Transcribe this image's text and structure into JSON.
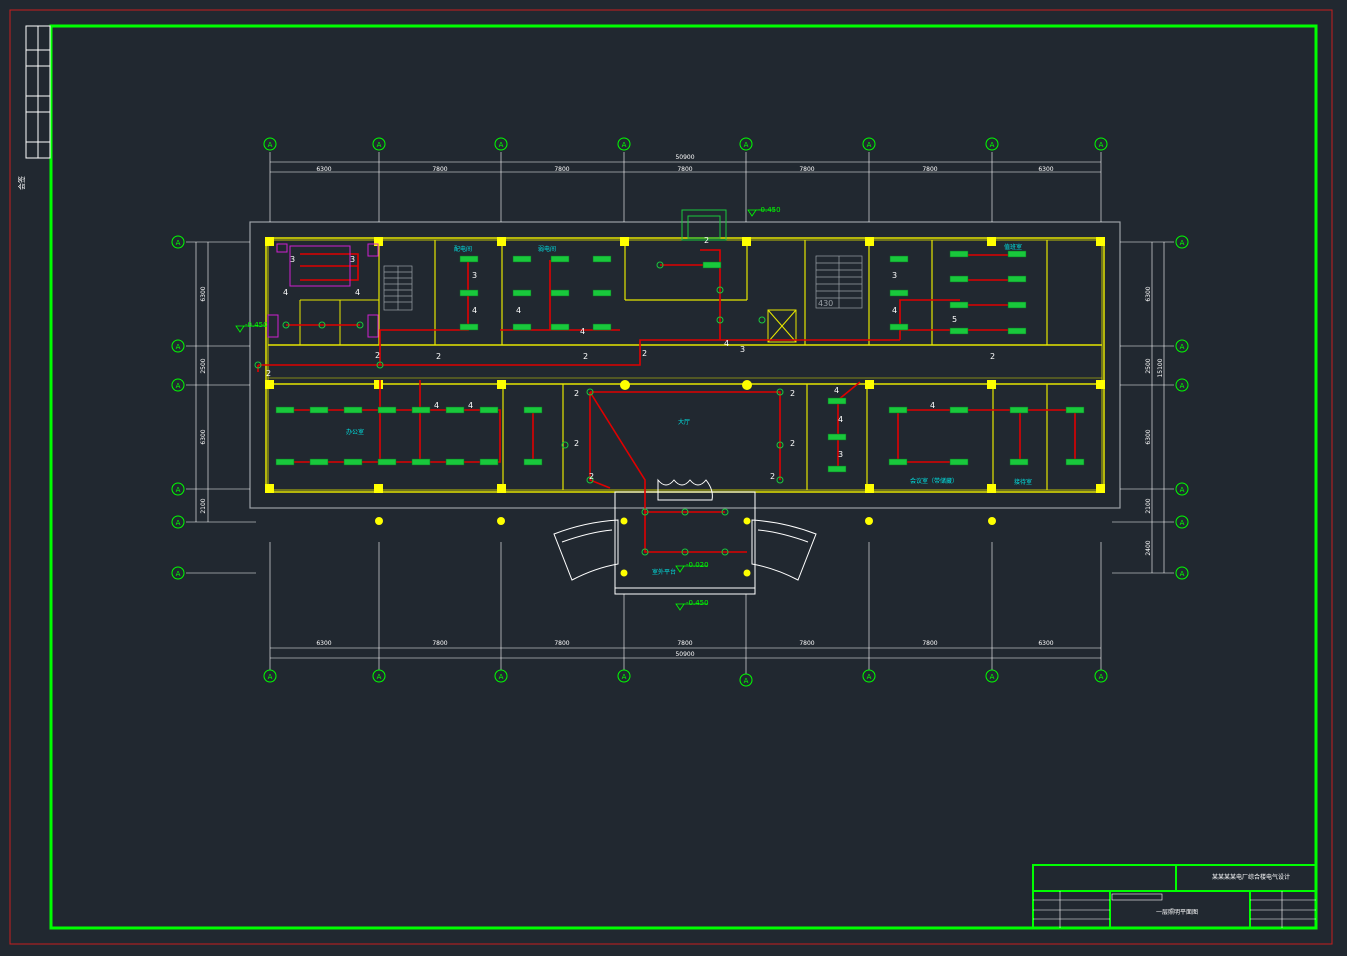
{
  "drawing": {
    "grid_top_labels": [
      "A",
      "A",
      "A",
      "A",
      "A",
      "A",
      "A",
      "A"
    ],
    "grid_side_labels": [
      "A",
      "A",
      "A",
      "A",
      "A",
      "A"
    ],
    "top_dims": [
      "6300",
      "7800",
      "7800",
      "7800",
      "7800",
      "7800",
      "6300"
    ],
    "top_total": "50900",
    "bottom_dims": [
      "6300",
      "7800",
      "7800",
      "7800",
      "7800",
      "7800",
      "6300"
    ],
    "bottom_total": "50900",
    "left_dims": [
      "6300",
      "2500",
      "6300",
      "2100"
    ],
    "right_dims": [
      "6300",
      "2500",
      "6300",
      "2100",
      "2400"
    ],
    "right_total": "15100",
    "elevation_top": "-0.450",
    "elevation_entry": "-0.020",
    "elevation_bottom": "-0.450",
    "elevation_left": "-0.450",
    "stair_number": "430",
    "lobby_label": "大厅",
    "platform_label": "室外平台",
    "office_label": "办公室",
    "meeting_label": "会议室（带储藏）",
    "room_label_1": "配电间",
    "room_label_2": "弱电间",
    "room_label_3": "值班室",
    "room_label_4": "接待室",
    "circuit_numbers": [
      "2",
      "3",
      "4",
      "5"
    ]
  },
  "title_block": {
    "project": "某某某某电厂综合楼电气设计",
    "drawing_name": "一层照明平面图",
    "side_label": "会签"
  },
  "colors": {
    "background": "#212830",
    "frame_green": "#00ff00",
    "outer_red": "#c81e1e",
    "wall_yellow": "#e6e600",
    "column_yellow": "#ffff00",
    "circuit_red": "#e00000",
    "fixture_green": "#19c83c",
    "text_cyan": "#00e0e0",
    "text_white": "#ffffff",
    "fixture_magenta": "#d020d0",
    "grey_outline": "#9aa0a6"
  }
}
